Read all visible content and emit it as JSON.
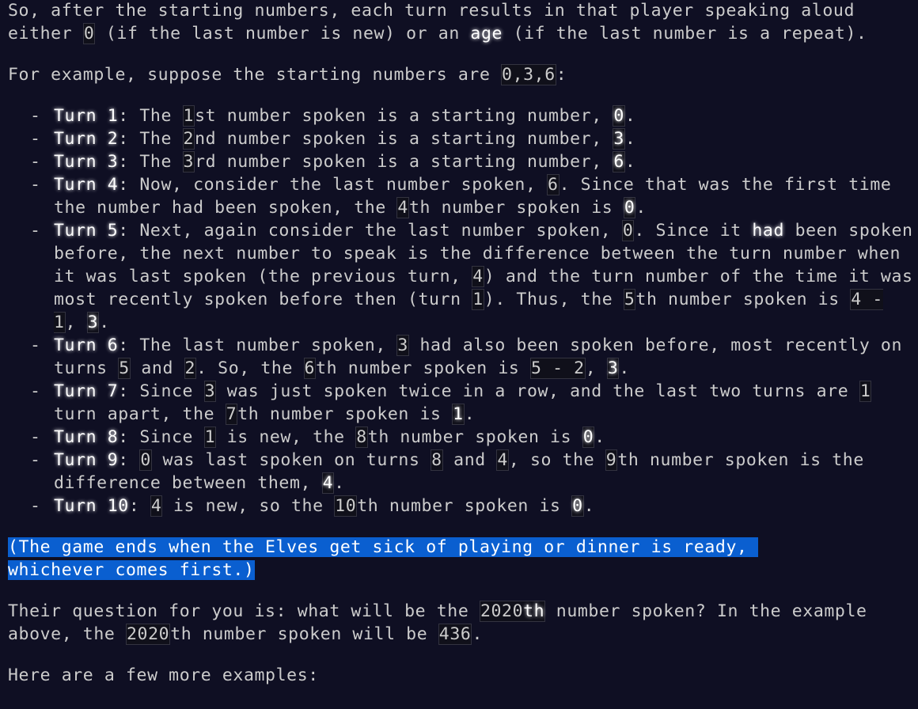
{
  "intro": {
    "p1": "So, after the starting numbers, each turn results in that player speaking aloud either ",
    "p1_code0": "0",
    "p1_mid": " (if the last number is new) or an ",
    "p1_em": "age",
    "p1_end": " (if the last number is a repeat).",
    "p2": "For example, suppose the starting numbers are ",
    "p2_code": "0,3,6",
    "p2_end": ":"
  },
  "turns": {
    "t1": {
      "label": "Turn 1",
      "a": ": The ",
      "c1": "1",
      "b": "st number spoken is a starting number, ",
      "c2": "0",
      "c": "."
    },
    "t2": {
      "label": "Turn 2",
      "a": ": The ",
      "c1": "2",
      "b": "nd number spoken is a starting number, ",
      "c2": "3",
      "c": "."
    },
    "t3": {
      "label": "Turn 3",
      "a": ": The ",
      "c1": "3",
      "b": "rd number spoken is a starting number, ",
      "c2": "6",
      "c": "."
    },
    "t4": {
      "label": "Turn 4",
      "a": ": Now, consider the last number spoken, ",
      "c1": "6",
      "b": ". Since that was the first time the number had been spoken, the ",
      "c2": "4",
      "c": "th number spoken is ",
      "c3": "0",
      "d": "."
    },
    "t5": {
      "label": "Turn 5",
      "a": ": Next, again consider the last number spoken, ",
      "c1": "0",
      "b": ". Since it ",
      "em": "had",
      "c": " been spoken before, the next number to speak is the difference between the turn number when it was last spoken (the previous turn, ",
      "c2": "4",
      "d": ") and the turn number of the time it was most recently spoken before then (turn ",
      "c3": "1",
      "e": "). Thus, the ",
      "c4": "5",
      "f": "th number spoken is ",
      "c5": "4 - 1",
      "g": ", ",
      "c6": "3",
      "h": "."
    },
    "t6": {
      "label": "Turn 6",
      "a": ": The last number spoken, ",
      "c1": "3",
      "b": " had also been spoken before, most recently on turns ",
      "c2": "5",
      "c": " and ",
      "c3": "2",
      "d": ". So, the ",
      "c4": "6",
      "e": "th number spoken is ",
      "c5": "5 - 2",
      "f": ", ",
      "c6": "3",
      "g": "."
    },
    "t7": {
      "label": "Turn 7",
      "a": ": Since ",
      "c1": "3",
      "b": " was just spoken twice in a row, and the last two turns are ",
      "c2": "1",
      "c": " turn apart, the ",
      "c3": "7",
      "d": "th number spoken is ",
      "c4": "1",
      "e": "."
    },
    "t8": {
      "label": "Turn 8",
      "a": ": Since ",
      "c1": "1",
      "b": " is new, the ",
      "c2": "8",
      "c": "th number spoken is ",
      "c3": "0",
      "d": "."
    },
    "t9": {
      "label": "Turn 9",
      "a": ": ",
      "c1": "0",
      "b": " was last spoken on turns ",
      "c2": "8",
      "c": " and ",
      "c3": "4",
      "d": ", so the ",
      "c4": "9",
      "e": "th number spoken is the difference between them, ",
      "c5": "4",
      "f": "."
    },
    "t10": {
      "label": "Turn 10",
      "a": ": ",
      "c1": "4",
      "b": " is new, so the ",
      "c2": "10",
      "c": "th number spoken is ",
      "c3": "0",
      "d": "."
    }
  },
  "aside": {
    "line1": "(The game ends when the Elves get sick of playing or dinner is ready, ",
    "line2": "whichever comes first.)"
  },
  "question": {
    "a": "Their question for you is: what will be the ",
    "c1": "2020",
    "c1_em": "th",
    "b": " number spoken? In the example above, the ",
    "c2": "2020",
    "c": "th number spoken will be ",
    "c3": "436",
    "d": "."
  },
  "more": {
    "text": "Here are a few more examples:"
  },
  "colors": {
    "background": "#0f0f23",
    "text": "#cccccc",
    "highlight": "#ffffff",
    "selection": "#0a5fd0"
  }
}
